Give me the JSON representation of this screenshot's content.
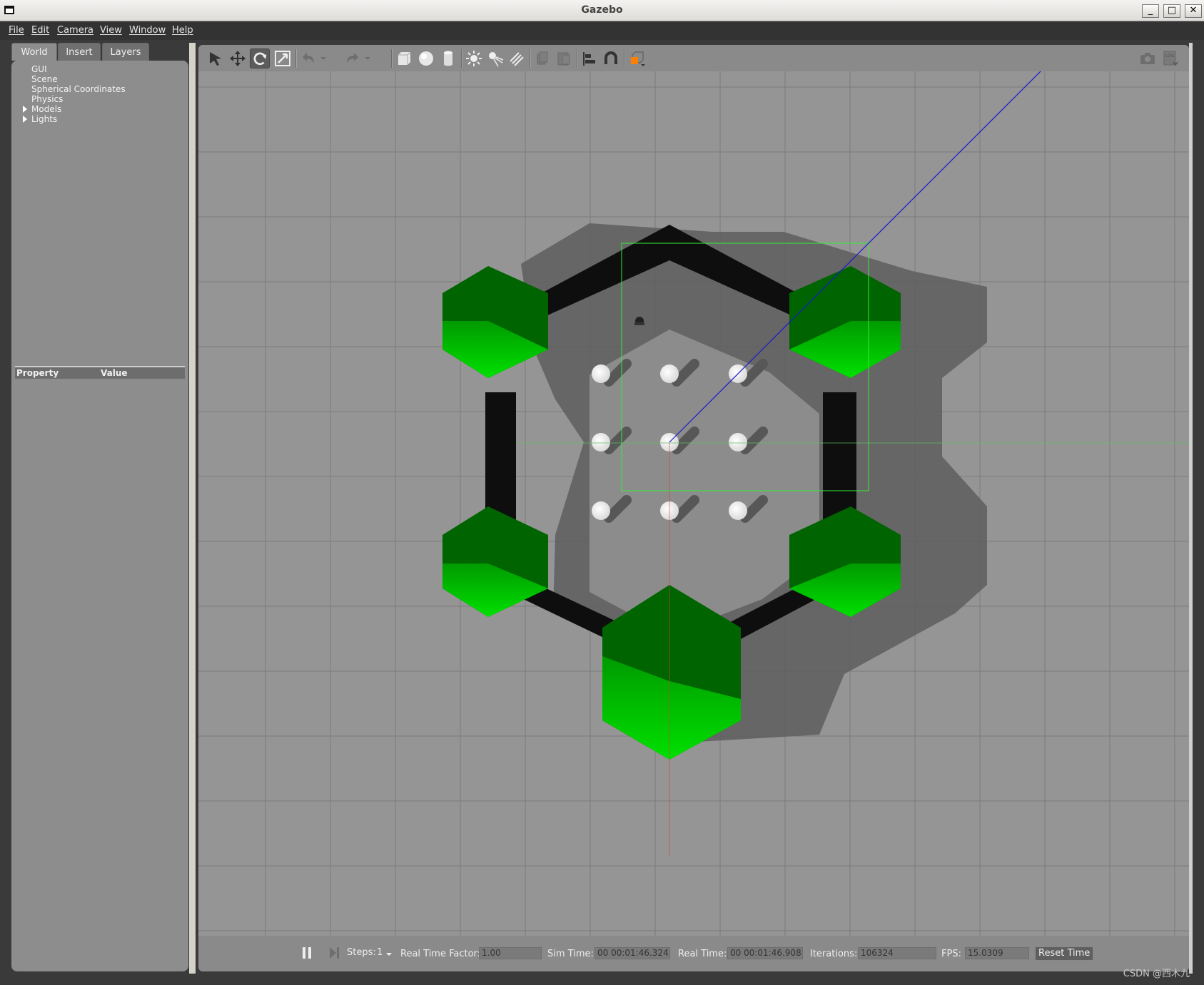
{
  "window": {
    "title": "Gazebo"
  },
  "menubar": {
    "items": [
      "File",
      "Edit",
      "Camera",
      "View",
      "Window",
      "Help"
    ]
  },
  "left_panel": {
    "tabs": [
      "World",
      "Insert",
      "Layers"
    ],
    "active_tab": "World",
    "tree": [
      {
        "label": "GUI",
        "expandable": false
      },
      {
        "label": "Scene",
        "expandable": false
      },
      {
        "label": "Spherical Coordinates",
        "expandable": false
      },
      {
        "label": "Physics",
        "expandable": false
      },
      {
        "label": "Models",
        "expandable": true
      },
      {
        "label": "Lights",
        "expandable": true
      }
    ],
    "property_header": {
      "property": "Property",
      "value": "Value"
    }
  },
  "toolbar": {
    "tools": [
      "select-arrow-icon",
      "translate-icon",
      "rotate-icon",
      "scale-icon",
      "undo-icon",
      "redo-icon",
      "box-icon",
      "sphere-icon",
      "cylinder-icon",
      "point-light-icon",
      "spot-light-icon",
      "directional-light-icon",
      "copy-icon",
      "paste-icon",
      "align-icon",
      "snap-icon",
      "view-angle-icon",
      "screenshot-icon",
      "log-icon"
    ],
    "active_tool": "rotate-icon"
  },
  "colors": {
    "viewport_bg": "#959595",
    "green_top": "#006400",
    "green_side": "#00d400",
    "frame": "#0e0e0e"
  },
  "bottom_bar": {
    "steps_label": "Steps:",
    "steps_value": "1",
    "rtf_label": "Real Time Factor:",
    "rtf_value": "1.00",
    "sim_time_label": "Sim Time:",
    "sim_time_value": "00 00:01:46.324",
    "real_time_label": "Real Time:",
    "real_time_value": "00 00:01:46.908",
    "iterations_label": "Iterations:",
    "iterations_value": "106324",
    "fps_label": "FPS:",
    "fps_value": "15.0309",
    "reset_label": "Reset Time"
  },
  "watermark": "CSDN @西木九"
}
